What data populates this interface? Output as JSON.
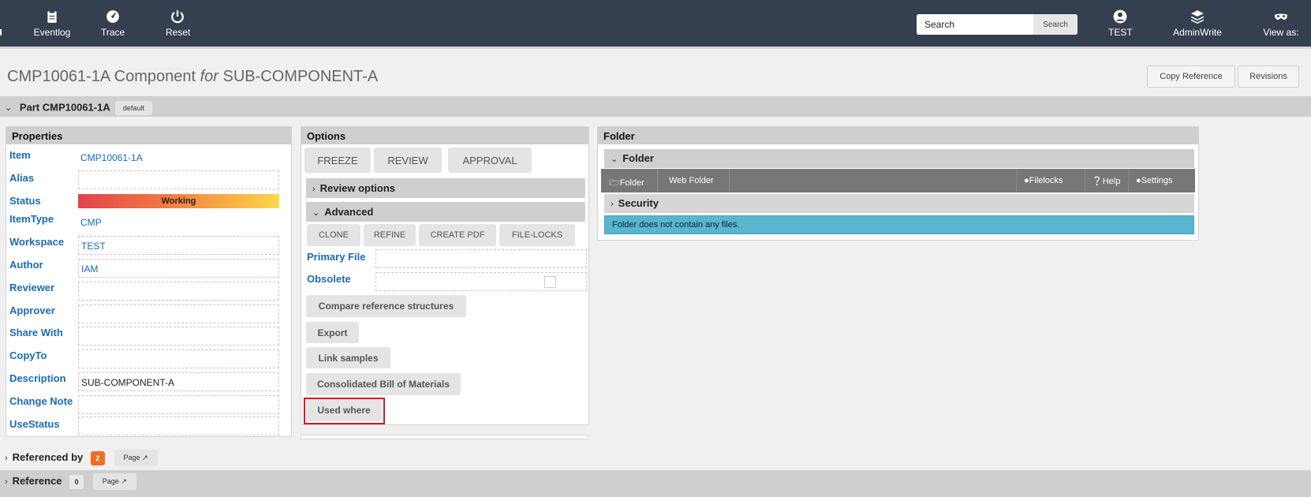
{
  "nav": {
    "items": [
      {
        "label": "Eventlog",
        "icon": "clipboard-icon"
      },
      {
        "label": "Trace",
        "icon": "speedometer-icon"
      },
      {
        "label": "Reset",
        "icon": "power-icon"
      }
    ],
    "search_placeholder": "Search",
    "search_button": "Search",
    "user": {
      "label": "TEST",
      "icon": "user-icon"
    },
    "role": {
      "label": "AdminWrite",
      "icon": "layers-icon"
    },
    "viewas": {
      "label": "View as:",
      "icon": "mask-icon"
    }
  },
  "header": {
    "title_prefix": "CMP10061-1A Component ",
    "title_for": "for",
    "title_suffix": " SUB-COMPONENT-A",
    "copy_reference": "Copy Reference",
    "revisions": "Revisions"
  },
  "part": {
    "label": "Part CMP10061-1A",
    "tag": "default"
  },
  "properties": {
    "title": "Properties",
    "rows": [
      {
        "label": "Item",
        "value": "CMP10061-1A"
      },
      {
        "label": "Alias",
        "value": ""
      },
      {
        "label": "Status",
        "value": "Working"
      },
      {
        "label": "ItemType",
        "value": "CMP"
      },
      {
        "label": "Workspace",
        "value": "TEST"
      },
      {
        "label": "Author",
        "value": "IAM"
      },
      {
        "label": "Reviewer",
        "value": ""
      },
      {
        "label": "Approver",
        "value": ""
      },
      {
        "label": "Share With",
        "value": ""
      },
      {
        "label": "CopyTo",
        "value": ""
      },
      {
        "label": "Description",
        "value": "SUB-COMPONENT-A"
      },
      {
        "label": "Change Note",
        "value": ""
      },
      {
        "label": "UseStatus",
        "value": ""
      }
    ]
  },
  "options": {
    "title": "Options",
    "main_buttons": [
      "FREEZE",
      "REVIEW",
      "APPROVAL"
    ],
    "review_options": "Review options",
    "advanced": "Advanced",
    "adv_buttons": [
      "CLONE",
      "REFINE",
      "CREATE PDF",
      "FILE-LOCKS"
    ],
    "primary_file": "Primary File",
    "obsolete": "Obsolete",
    "actions": [
      "Compare reference structures",
      "Export",
      "Link samples",
      "Consolidated Bill of Materials",
      "Used where"
    ]
  },
  "folder": {
    "title": "Folder",
    "subhead": "Folder",
    "toolbar": {
      "folder": "Folder",
      "web_folder": "Web Folder",
      "filelocks": "Filelocks",
      "help": "Help",
      "settings": "Settings"
    },
    "security": "Security",
    "empty_msg": "Folder does not contain any files."
  },
  "bottom": {
    "referenced_by": "Referenced by",
    "referenced_by_count": "2",
    "reference": "Reference",
    "reference_count": "0",
    "page": "Page"
  },
  "colors": {
    "topbar": "#343f4f",
    "link": "#1a6bb5",
    "info": "#58b6d0",
    "badge": "#f26d21",
    "highlight": "#e0141c"
  }
}
